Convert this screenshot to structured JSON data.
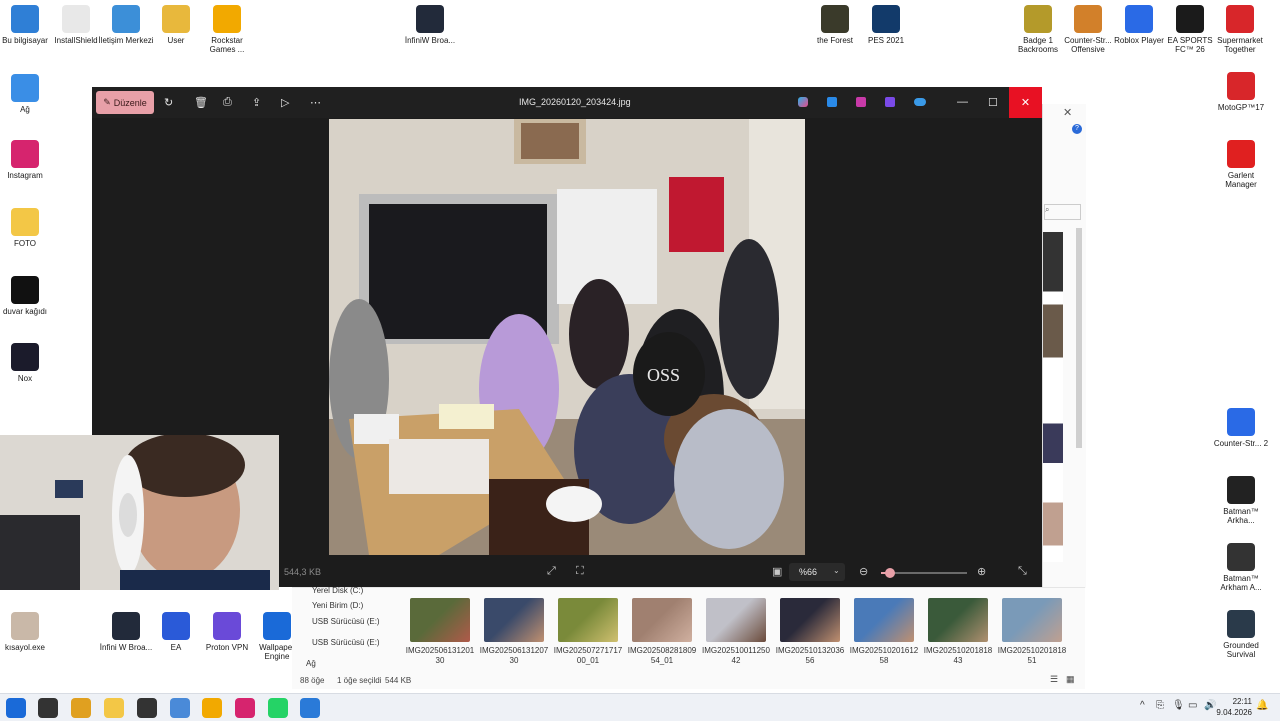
{
  "desktop_icons_left": [
    {
      "label": "Bu bilgisayar",
      "icon": "computer-icon",
      "color": "#2f7fd6"
    },
    {
      "label": "InstallShield",
      "icon": "document-icon",
      "color": "#e8e8e8"
    },
    {
      "label": "İletişim Merkezi",
      "icon": "monitor-icon",
      "color": "#3c8fd8"
    },
    {
      "label": "User",
      "icon": "user-folder-icon",
      "color": "#e8b83c"
    },
    {
      "label": "Rockstar Games ...",
      "icon": "rockstar-icon",
      "color": "#f2a900"
    },
    {
      "label": "İnfiniW Broa...",
      "icon": "camera-icon",
      "color": "#222a3a"
    }
  ],
  "desktop_icons_col": [
    {
      "label": "Ağ",
      "icon": "network-icon",
      "color": "#3a8ee6"
    },
    {
      "label": "Instagram",
      "icon": "instagram-icon",
      "color": "#d6246e"
    },
    {
      "label": "FOTO",
      "icon": "folder-icon",
      "color": "#f3c746"
    },
    {
      "label": "duvar kağıdı",
      "icon": "image-icon",
      "color": "#111111"
    },
    {
      "label": "Nox",
      "icon": "nox-icon",
      "color": "#1b1b2b"
    }
  ],
  "desktop_icons_top_right": [
    {
      "label": "the Forest",
      "icon": "forest-icon",
      "color": "#3a3a2a"
    },
    {
      "label": "PES 2021",
      "icon": "pes-icon",
      "color": "#123a6a"
    },
    {
      "label": "Badge 1 Backrooms",
      "icon": "badge-icon",
      "color": "#b49a2a"
    },
    {
      "label": "Counter-Str... Offensive",
      "icon": "counter-strike-icon",
      "color": "#d2802a"
    },
    {
      "label": "Roblox Player",
      "icon": "roblox-icon",
      "color": "#2a6ae6"
    },
    {
      "label": "EA SPORTS FC™ 26",
      "icon": "ea-fc-icon",
      "color": "#1b1b1b"
    },
    {
      "label": "Supermarket Together",
      "icon": "supermarket-icon",
      "color": "#d8262a"
    }
  ],
  "desktop_icons_right": [
    {
      "label": "MotoGP™17",
      "icon": "motogp-icon",
      "color": "#d8262a"
    },
    {
      "label": "Garlent Manager",
      "icon": "garlent-icon",
      "color": "#e02020"
    },
    {
      "label": "Counter-Str... 2",
      "icon": "counter-strike-icon",
      "color": "#2a6ae6"
    },
    {
      "label": "Batman™ Arkha...",
      "icon": "batman-icon",
      "color": "#222222"
    },
    {
      "label": "Batman™ Arkham A...",
      "icon": "batman-icon",
      "color": "#333333"
    },
    {
      "label": "Grounded Survival",
      "icon": "grounded-icon",
      "color": "#2a3a4a"
    }
  ],
  "desktop_icons_bottom": [
    {
      "label": "kısayol.exe",
      "icon": "user-icon",
      "color": "#c9b8a8"
    },
    {
      "label": "İnfini W Broa...",
      "icon": "camera-icon",
      "color": "#222a3a"
    },
    {
      "label": "EA",
      "icon": "ea-icon",
      "color": "#2a5ad8"
    },
    {
      "label": "Proton VPN",
      "icon": "proton-vpn-icon",
      "color": "#6a4ad8"
    },
    {
      "label": "Wallpaper Engine",
      "icon": "wallpaper-engine-icon",
      "color": "#1a6ad8"
    }
  ],
  "viewer": {
    "edit_label": "Düzenle",
    "filename": "IMG_20260120_203424.jpg",
    "file_size": "544,3 KB",
    "zoom": "%66",
    "zoom_level": 0.1
  },
  "explorer": {
    "tree": [
      "Yerel Disk (C:)",
      "Yeni Birim (D:)",
      "USB Sürücüsü (E:)",
      "USB Sürücüsü (E:)",
      "Ağ"
    ],
    "thumbnails": [
      {
        "label": "IMG2025061312​0130",
        "c1": "#5a6a3a",
        "c2": "#b05a4a"
      },
      {
        "label": "IMG20250613120730",
        "c1": "#3a4a6a",
        "c2": "#c09070"
      },
      {
        "label": "IMG20250727171700_01",
        "c1": "#7a8a3a",
        "c2": "#d0c070"
      },
      {
        "label": "IMG20250828180954_01",
        "c1": "#a08070",
        "c2": "#d0b0a0"
      },
      {
        "label": "IMG20251001125042",
        "c1": "#c0c0c8",
        "c2": "#6a4a3a"
      },
      {
        "label": "IMG20251013203656",
        "c1": "#2a2a3a",
        "c2": "#c09070"
      },
      {
        "label": "IMG20251020161258",
        "c1": "#4a7ab8",
        "c2": "#c09070"
      },
      {
        "label": "IMG20251020181843",
        "c1": "#3a5a3a",
        "c2": "#b09070"
      },
      {
        "label": "IMG20251020181851",
        "c1": "#7a9ab8",
        "c2": "#c0a090"
      }
    ],
    "status_count": "88 öğe",
    "status_selected": "1 öğe seçildi",
    "status_size": "544 KB"
  },
  "taskbar": {
    "time": "22:11",
    "date": "9.04.2026",
    "apps": [
      {
        "icon": "windows-start-icon",
        "color": "#1a6ad8"
      },
      {
        "icon": "search-icon",
        "color": "#333333"
      },
      {
        "icon": "chrome-icon",
        "color": "#e0a020"
      },
      {
        "icon": "file-explorer-icon",
        "color": "#f3c746"
      },
      {
        "icon": "garlent-icon",
        "color": "#333333"
      },
      {
        "icon": "photos-app-icon",
        "color": "#4a8ad8"
      },
      {
        "icon": "rockstar-icon",
        "color": "#f2a900"
      },
      {
        "icon": "instagram-icon",
        "color": "#d6246e"
      },
      {
        "icon": "whatsapp-icon",
        "color": "#25d366"
      },
      {
        "icon": "photos-viewer-icon",
        "color": "#2a7ad8"
      }
    ]
  },
  "colors": {
    "accent": "#e8a0a8",
    "close": "#e81123",
    "viewer_bg": "#1c1c1c"
  }
}
